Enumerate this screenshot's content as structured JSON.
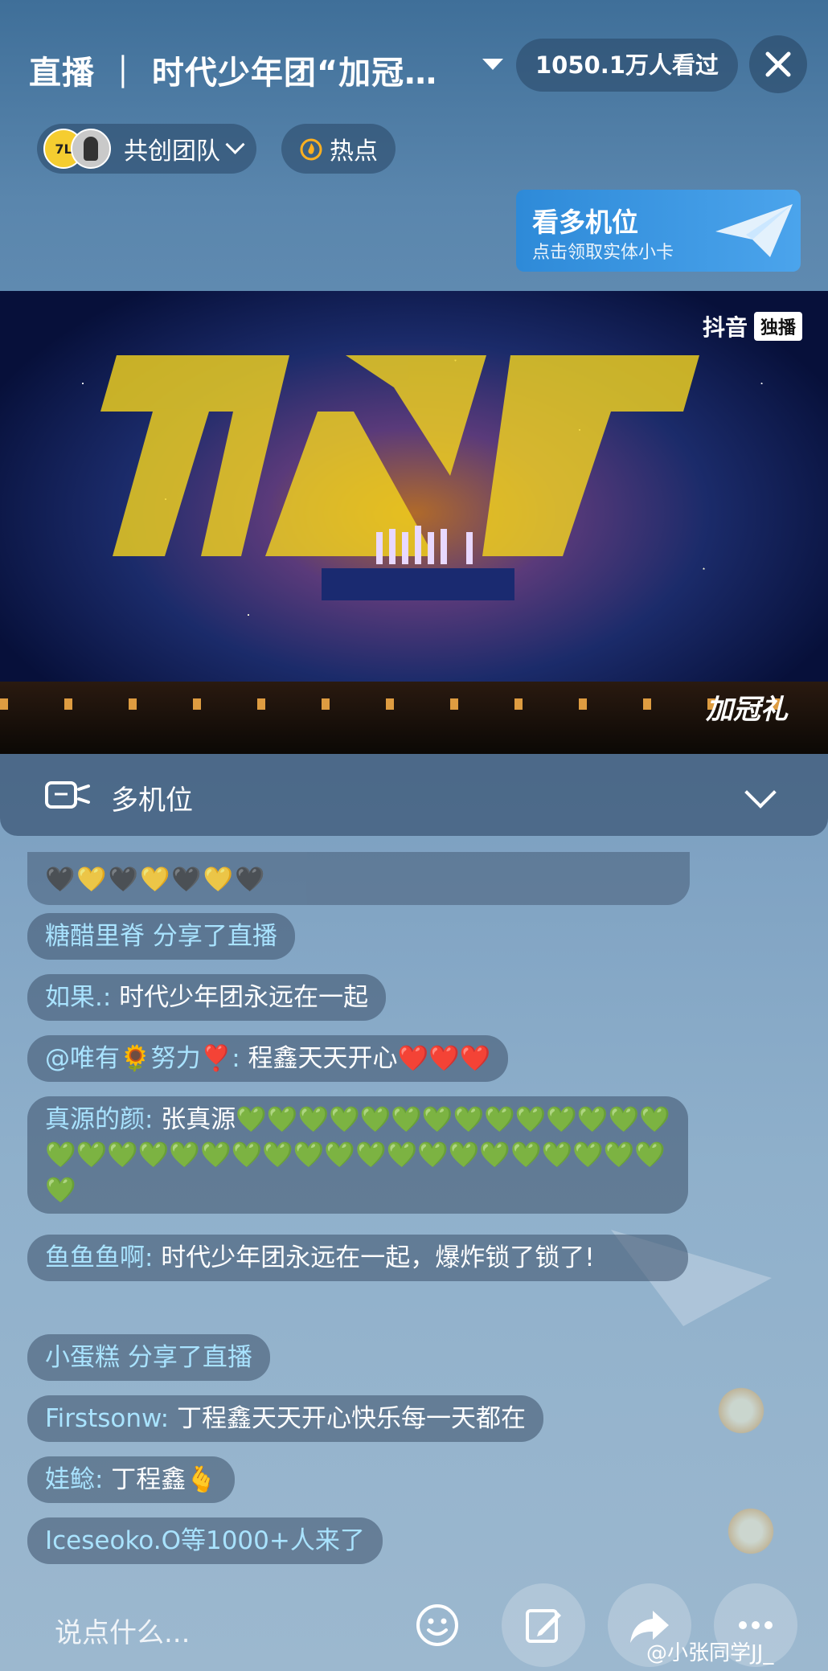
{
  "header": {
    "title": "直播 ｜ 时代少年团“加冠…",
    "viewers": "1050.1万人看过",
    "team_label": "共创团队",
    "avatar_text": "7L",
    "hot_label": "热点",
    "multicam_card": {
      "title": "看多机位",
      "subtitle": "点击领取实体小卡"
    }
  },
  "video": {
    "watermark": "抖音",
    "watermark_badge": "独播",
    "corner_text": "加冠礼"
  },
  "multicam_bar": {
    "label": "多机位"
  },
  "chat": [
    {
      "user": "",
      "text": "🖤💛🖤💛🖤💛🖤"
    },
    {
      "user": "糖醋里脊 分享了直播",
      "text": ""
    },
    {
      "user": "如果.:",
      "text": " 时代少年团永远在一起"
    },
    {
      "user": "@唯有🌻努力❣️:",
      "text": " 程鑫天天开心❤️❤️❤️"
    },
    {
      "user": "真源的颜:",
      "text": " 张真源💚💚💚💚💚💚💚💚💚💚💚💚💚💚💚💚💚💚💚💚💚💚💚💚💚💚💚💚💚💚💚💚💚💚💚"
    },
    {
      "user": "鱼鱼鱼啊:",
      "text": " 时代少年团永远在一起，爆炸锁了锁了!"
    },
    {
      "user": "小蛋糕 分享了直播",
      "text": ""
    },
    {
      "user": "Firstsonw:",
      "text": " 丁程鑫天天开心快乐每一天都在"
    },
    {
      "user": "娃鲶:",
      "text": " 丁程鑫🫰"
    },
    {
      "user": "Iceseoko.O等1000+人来了",
      "text": ""
    }
  ],
  "bottom": {
    "input_placeholder": "说点什么...",
    "credit": "@小张同学JJ_"
  },
  "colors": {
    "accent": "#3b9be6",
    "username": "#a9e3ff",
    "logo_yellow": "#f2d21e"
  },
  "icons": [
    "close-icon",
    "flame-icon",
    "paper-plane-icon",
    "multicam-icon",
    "chevron-down-icon",
    "emoji-icon",
    "edit-icon",
    "share-icon",
    "more-icon"
  ]
}
